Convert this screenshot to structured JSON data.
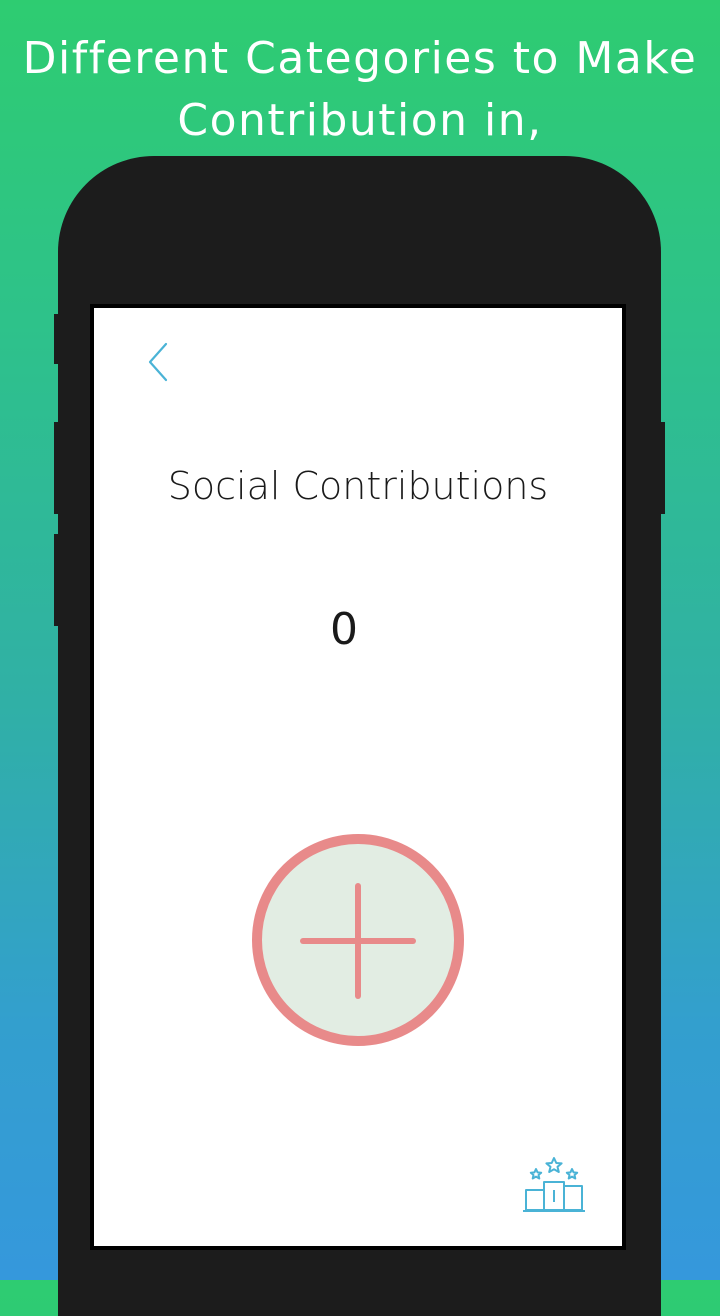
{
  "headline": {
    "line1": "Different Categories to Make",
    "line2": "Contribution in,"
  },
  "screen": {
    "title": "Social Contributions",
    "count": "0"
  },
  "colors": {
    "background_top": "#2ecc71",
    "background_bottom": "#3598dc",
    "phone_body": "#1c1c1c",
    "accent_blue": "#4ab3d6",
    "add_ring": "#e88a8a",
    "add_fill": "#e2ede3",
    "add_shadow": "#e02020"
  },
  "icons": {
    "back": "chevron-left-icon",
    "add": "plus-icon",
    "leaderboard": "podium-icon"
  }
}
